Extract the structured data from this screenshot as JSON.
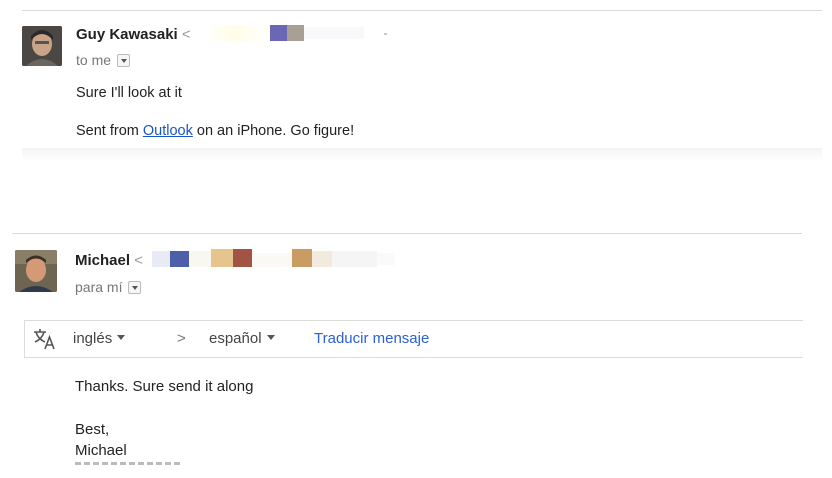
{
  "messages": [
    {
      "sender_name": "Guy Kawasaki",
      "sender_open": "<",
      "recipient_label": "to me",
      "body_line1": "Sure I'll look at it",
      "signature_prefix": "Sent from ",
      "signature_link": "Outlook",
      "signature_suffix": " on an iPhone. Go figure!"
    },
    {
      "sender_name": "Michael",
      "sender_open": "<",
      "recipient_label": "para mí",
      "translate_bar": {
        "icon": "translate-icon",
        "source_language": "inglés",
        "arrow": ">",
        "target_language": "español",
        "action_label": "Traducir mensaje"
      },
      "body_line1": "Thanks. Sure send it along",
      "closing": "Best,",
      "signature_name": "Michael"
    }
  ],
  "colors": {
    "link": "#1a54c7",
    "translate_action": "#2a62d1",
    "divider": "#d9d9d9"
  }
}
